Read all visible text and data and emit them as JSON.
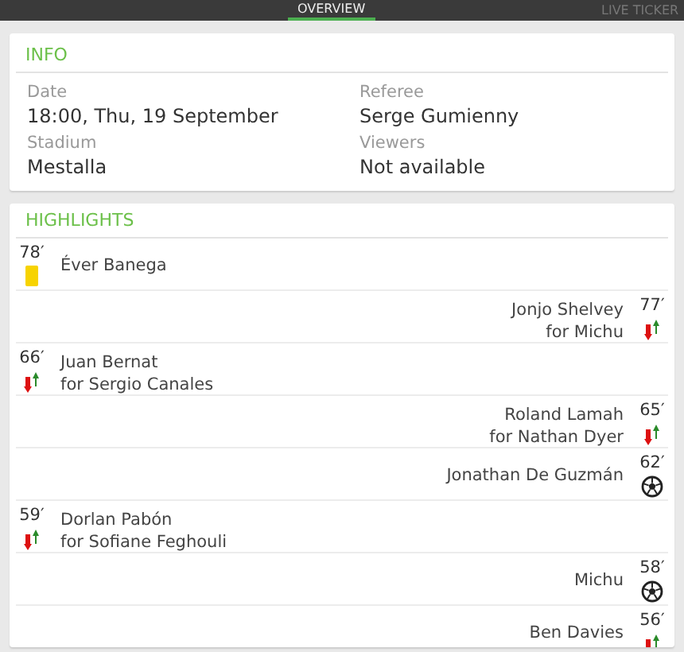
{
  "tabs": [
    {
      "label": "OVERVIEW",
      "selected": true
    },
    {
      "label": "LIVE TICKER",
      "selected": false
    }
  ],
  "info": {
    "title": "INFO",
    "fields": [
      {
        "label": "Date",
        "value": "18:00, Thu, 19 September"
      },
      {
        "label": "Referee",
        "value": "Serge Gumienny"
      },
      {
        "label": "Stadium",
        "value": "Mestalla"
      },
      {
        "label": "Viewers",
        "value": "Not available"
      }
    ]
  },
  "highlights": {
    "title": "HIGHLIGHTS",
    "events": [
      {
        "minute": "78′",
        "away": false,
        "kind": "yellow_card",
        "player": "Éver Banega"
      },
      {
        "minute": "77′",
        "away": true,
        "kind": "substitution",
        "player": "Jonjo Shelvey",
        "detail": "for Michu"
      },
      {
        "minute": "66′",
        "away": false,
        "kind": "substitution",
        "player": "Juan Bernat",
        "detail": "for Sergio Canales"
      },
      {
        "minute": "65′",
        "away": true,
        "kind": "substitution",
        "player": "Roland Lamah",
        "detail": "for Nathan Dyer"
      },
      {
        "minute": "62′",
        "away": true,
        "kind": "goal",
        "player": "Jonathan De Guzmán"
      },
      {
        "minute": "59′",
        "away": false,
        "kind": "substitution",
        "player": "Dorlan Pabón",
        "detail": "for Sofiane Feghouli"
      },
      {
        "minute": "58′",
        "away": true,
        "kind": "goal",
        "player": "Michu"
      },
      {
        "minute": "56′",
        "away": true,
        "kind": "substitution",
        "player": "Ben Davies"
      }
    ]
  }
}
